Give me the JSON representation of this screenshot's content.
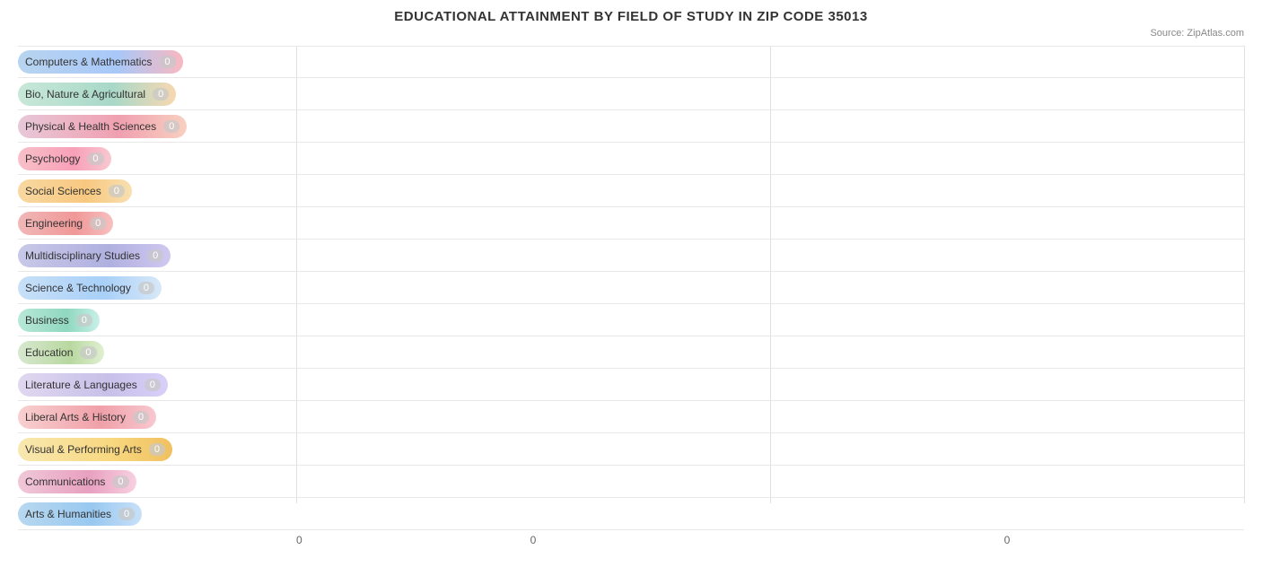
{
  "title": "EDUCATIONAL ATTAINMENT BY FIELD OF STUDY IN ZIP CODE 35013",
  "source": "Source: ZipAtlas.com",
  "rows": [
    {
      "label": "Computers & Mathematics",
      "value": 0,
      "pillClass": "pill-0"
    },
    {
      "label": "Bio, Nature & Agricultural",
      "value": 0,
      "pillClass": "pill-1"
    },
    {
      "label": "Physical & Health Sciences",
      "value": 0,
      "pillClass": "pill-2"
    },
    {
      "label": "Psychology",
      "value": 0,
      "pillClass": "pill-3"
    },
    {
      "label": "Social Sciences",
      "value": 0,
      "pillClass": "pill-4"
    },
    {
      "label": "Engineering",
      "value": 0,
      "pillClass": "pill-5"
    },
    {
      "label": "Multidisciplinary Studies",
      "value": 0,
      "pillClass": "pill-6"
    },
    {
      "label": "Science & Technology",
      "value": 0,
      "pillClass": "pill-7"
    },
    {
      "label": "Business",
      "value": 0,
      "pillClass": "pill-8"
    },
    {
      "label": "Education",
      "value": 0,
      "pillClass": "pill-9"
    },
    {
      "label": "Literature & Languages",
      "value": 0,
      "pillClass": "pill-10"
    },
    {
      "label": "Liberal Arts & History",
      "value": 0,
      "pillClass": "pill-11"
    },
    {
      "label": "Visual & Performing Arts",
      "value": 0,
      "pillClass": "pill-12"
    },
    {
      "label": "Communications",
      "value": 0,
      "pillClass": "pill-13"
    },
    {
      "label": "Arts & Humanities",
      "value": 0,
      "pillClass": "pill-14"
    }
  ],
  "xAxisLabels": [
    "0",
    "0",
    "0"
  ],
  "gridLinePositions": [
    0,
    50,
    100
  ]
}
